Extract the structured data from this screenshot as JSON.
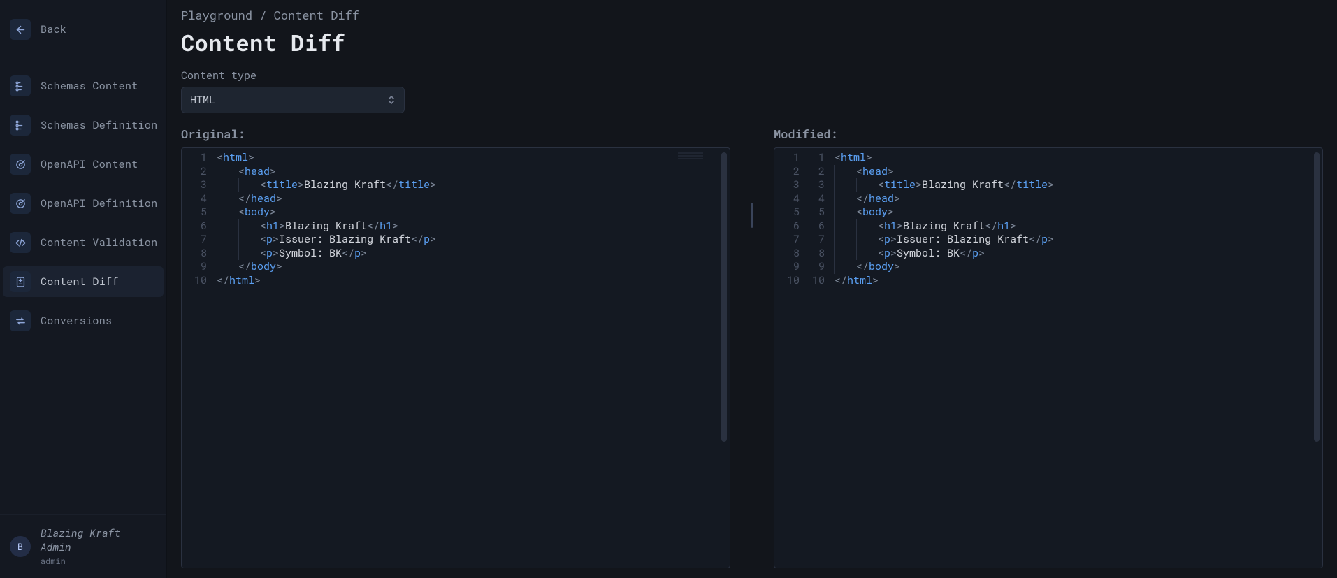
{
  "sidebar": {
    "back": {
      "label": "Back"
    },
    "items": [
      {
        "label": "Schemas Content",
        "icon": "tree-icon"
      },
      {
        "label": "Schemas Definition",
        "icon": "tree-icon"
      },
      {
        "label": "OpenAPI Content",
        "icon": "target-icon"
      },
      {
        "label": "OpenAPI Definition",
        "icon": "target-icon"
      },
      {
        "label": "Content Validation",
        "icon": "code-icon"
      },
      {
        "label": "Content Diff",
        "icon": "diff-icon"
      },
      {
        "label": "Conversions",
        "icon": "swap-icon"
      }
    ],
    "active_index": 5,
    "user": {
      "avatar_initial": "B",
      "name": "Blazing Kraft Admin",
      "role": "admin"
    }
  },
  "main": {
    "breadcrumb": "Playground / Content Diff",
    "title": "Content Diff",
    "content_type_label": "Content type",
    "content_type_value": "HTML",
    "original_label": "Original:",
    "modified_label": "Modified:",
    "code_lines": [
      {
        "indent": 0,
        "kind": "open",
        "tag": "html"
      },
      {
        "indent": 1,
        "kind": "open",
        "tag": "head"
      },
      {
        "indent": 2,
        "kind": "pair",
        "tag": "title",
        "text": "Blazing Kraft"
      },
      {
        "indent": 1,
        "kind": "close",
        "tag": "head"
      },
      {
        "indent": 1,
        "kind": "open",
        "tag": "body"
      },
      {
        "indent": 2,
        "kind": "pair",
        "tag": "h1",
        "text": "Blazing Kraft"
      },
      {
        "indent": 2,
        "kind": "pair",
        "tag": "p",
        "text": "Issuer: Blazing Kraft"
      },
      {
        "indent": 2,
        "kind": "pair",
        "tag": "p",
        "text": "Symbol: BK"
      },
      {
        "indent": 1,
        "kind": "close",
        "tag": "body"
      },
      {
        "indent": 0,
        "kind": "close",
        "tag": "html"
      }
    ]
  }
}
